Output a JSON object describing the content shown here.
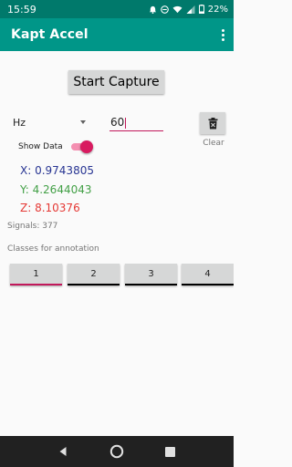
{
  "status_bar": {
    "time": "15:59",
    "battery": "22%",
    "icons": [
      "notification-icon",
      "do-not-disturb-icon",
      "wifi-icon",
      "signal-icon",
      "battery-icon"
    ]
  },
  "app_bar": {
    "title": "Kapt Accel",
    "menu_icon": "overflow-menu-icon"
  },
  "capture": {
    "start_label": "Start Capture"
  },
  "frequency": {
    "unit": "Hz",
    "value": "60"
  },
  "clear": {
    "label": "Clear",
    "icon": "delete-icon"
  },
  "show_data": {
    "label": "Show Data",
    "checked": true
  },
  "readings": {
    "x": "X: 0.9743805",
    "y": "Y: 4.2644043",
    "z": "Z: 8.10376"
  },
  "signals": {
    "text": "Signals: 377"
  },
  "classes": {
    "title": "Classes for annotation",
    "buttons": [
      {
        "label": "1",
        "active": true
      },
      {
        "label": "2",
        "active": false
      },
      {
        "label": "3",
        "active": false
      },
      {
        "label": "4",
        "active": false
      }
    ]
  },
  "colors": {
    "status_bar": "#00796b",
    "app_bar": "#009688",
    "accent": "#d81b60",
    "x_value": "#283593",
    "y_value": "#43a047",
    "z_value": "#e53935"
  },
  "nav_bar": {
    "icons": [
      "back-icon",
      "home-icon",
      "recents-icon"
    ]
  }
}
